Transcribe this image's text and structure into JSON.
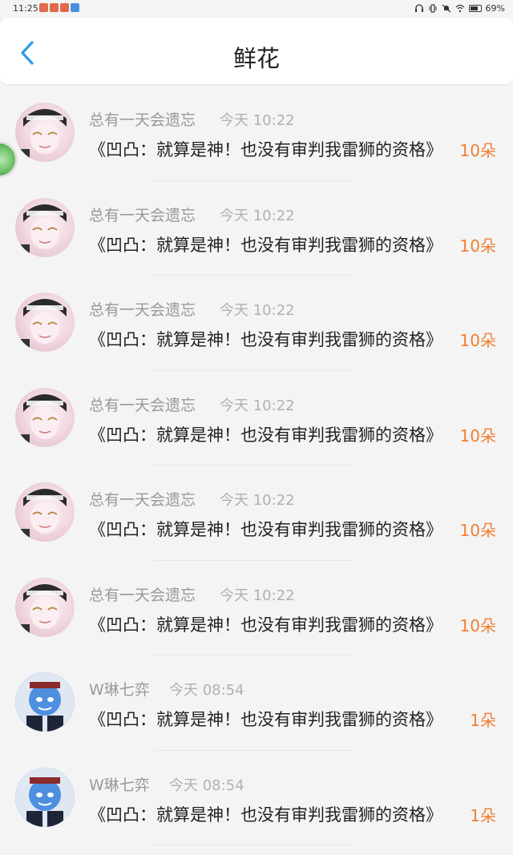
{
  "status_bar": {
    "time": "11:25",
    "battery": "69%"
  },
  "header": {
    "title": "鲜花"
  },
  "messages": [
    {
      "username": "总有一天会遗忘",
      "time": "今天 10:22",
      "text": "《凹凸：就算是神！也没有审判我雷狮的资格》",
      "count": "10朵",
      "avatar": "pink"
    },
    {
      "username": "总有一天会遗忘",
      "time": "今天 10:22",
      "text": "《凹凸：就算是神！也没有审判我雷狮的资格》",
      "count": "10朵",
      "avatar": "pink"
    },
    {
      "username": "总有一天会遗忘",
      "time": "今天 10:22",
      "text": "《凹凸：就算是神！也没有审判我雷狮的资格》",
      "count": "10朵",
      "avatar": "pink"
    },
    {
      "username": "总有一天会遗忘",
      "time": "今天 10:22",
      "text": "《凹凸：就算是神！也没有审判我雷狮的资格》",
      "count": "10朵",
      "avatar": "pink"
    },
    {
      "username": "总有一天会遗忘",
      "time": "今天 10:22",
      "text": "《凹凸：就算是神！也没有审判我雷狮的资格》",
      "count": "10朵",
      "avatar": "pink"
    },
    {
      "username": "总有一天会遗忘",
      "time": "今天 10:22",
      "text": "《凹凸：就算是神！也没有审判我雷狮的资格》",
      "count": "10朵",
      "avatar": "pink"
    },
    {
      "username": "W琳七弈",
      "time": "今天 08:54",
      "text": "《凹凸：就算是神！也没有审判我雷狮的资格》",
      "count": "1朵",
      "avatar": "blue"
    },
    {
      "username": "W琳七弈",
      "time": "今天 08:54",
      "text": "《凹凸：就算是神！也没有审判我雷狮的资格》",
      "count": "1朵",
      "avatar": "blue"
    }
  ],
  "colors": {
    "accent": "#2f9be8",
    "count": "#ef7f34"
  }
}
